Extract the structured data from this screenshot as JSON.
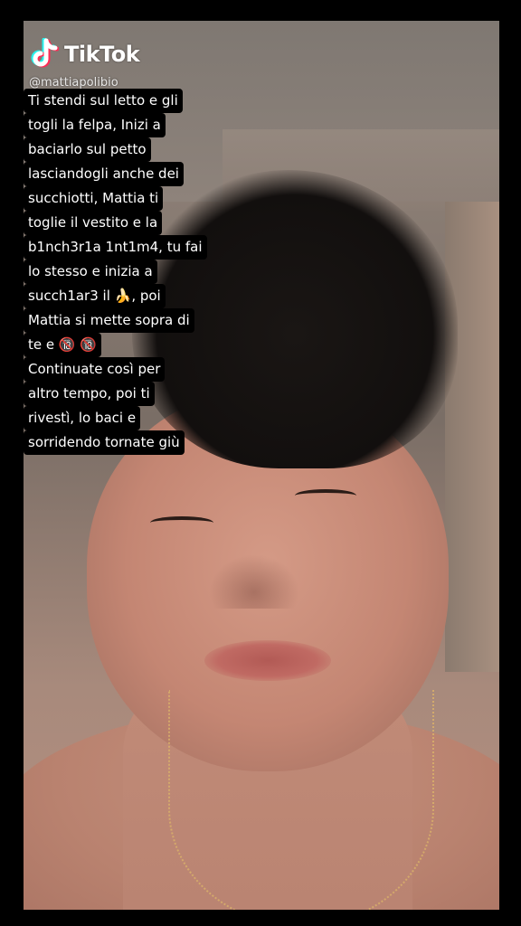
{
  "brand": {
    "name": "TikTok",
    "icon": "tiktok-logo-icon",
    "text_color": "#ffffff",
    "icon_colors": [
      "#25f4ee",
      "#fe2c55",
      "#ffffff"
    ]
  },
  "username": "@mattiapolibio",
  "caption": {
    "background": "#000000",
    "text_color": "#ffffff",
    "lines": [
      "Ti stendi sul letto e gli",
      "togli la felpa, Inizi a",
      "baciarlo sul petto",
      "lasciandogli anche dei",
      "succhiotti, Mattia ti",
      "toglie il vestito e la",
      "b1nch3r1a 1nt1m4, tu fai",
      "lo stesso e inizia a",
      "succh1ar3 il 🍌, poi",
      "Mattia si mette sopra di",
      "te e 🔞 🔞",
      "Continuate così per",
      "altro tempo, poi ti",
      "rivestì, lo baci e",
      "sorridendo tornate giù"
    ]
  }
}
